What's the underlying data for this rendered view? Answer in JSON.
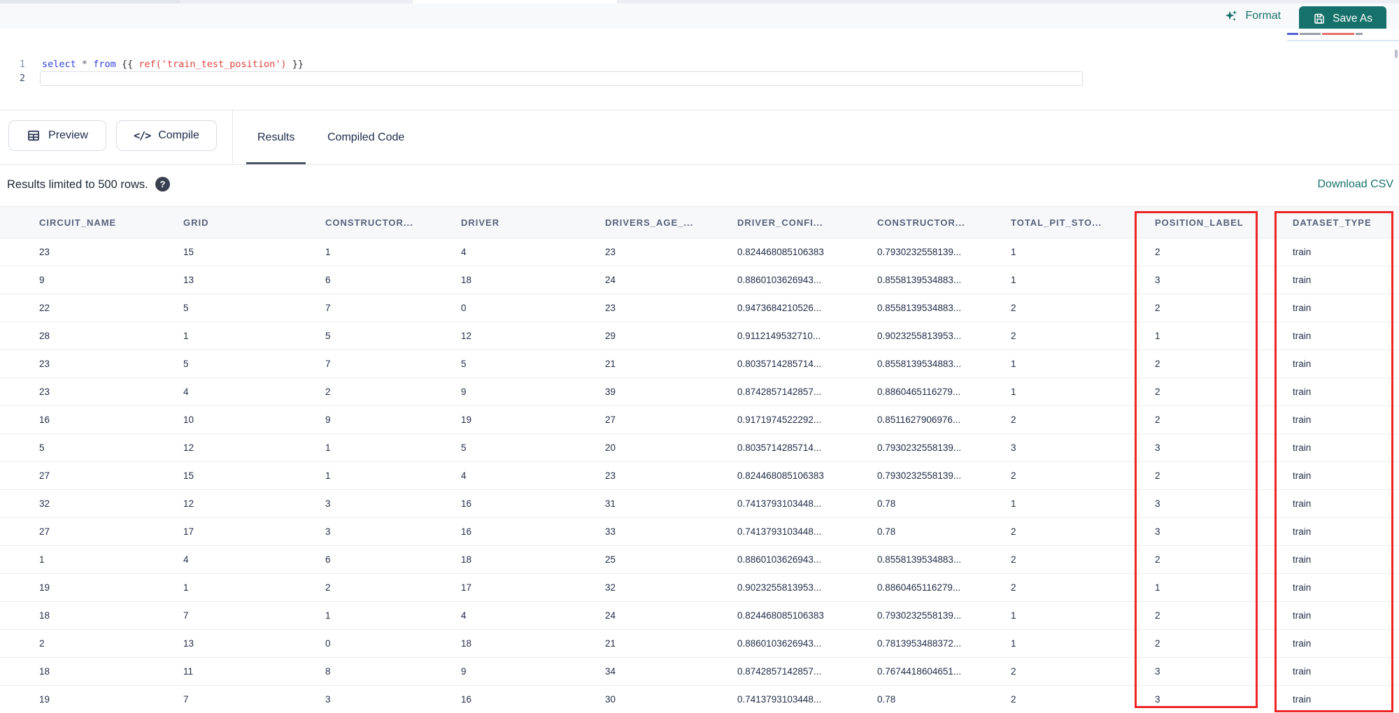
{
  "app": {
    "accent_teal": "#17716B",
    "annotation_red": "#EE2424"
  },
  "toolbar": {
    "format_label": "Format",
    "save_as_label": "Save As"
  },
  "editor": {
    "line_numbers": [
      "1",
      "2"
    ],
    "code_tokens": [
      {
        "text": "select",
        "type": "keyword"
      },
      {
        "text": " ",
        "type": "plain"
      },
      {
        "text": "*",
        "type": "operator"
      },
      {
        "text": " ",
        "type": "plain"
      },
      {
        "text": "from",
        "type": "keyword"
      },
      {
        "text": " {{ ",
        "type": "plain"
      },
      {
        "text": "ref('train_test_position')",
        "type": "string"
      },
      {
        "text": " }}",
        "type": "plain"
      }
    ]
  },
  "action_bar": {
    "preview_label": "Preview",
    "compile_label": "Compile",
    "compile_icon_text": "</>",
    "tabs": [
      {
        "label": "Results",
        "active": true
      },
      {
        "label": "Compiled Code",
        "active": false
      }
    ]
  },
  "results_bar": {
    "limit_text": "Results limited to 500 rows.",
    "help_icon": "?",
    "download_csv_label": "Download CSV"
  },
  "table": {
    "headers": [
      "CIRCUIT_NAME",
      "GRID",
      "CONSTRUCTOR...",
      "DRIVER",
      "DRIVERS_AGE_...",
      "DRIVER_CONFI...",
      "CONSTRUCTOR...",
      "TOTAL_PIT_STO...",
      "POSITION_LABEL",
      "DATASET_TYPE"
    ],
    "highlighted_columns": [
      "POSITION_LABEL",
      "DATASET_TYPE"
    ],
    "rows": [
      [
        "23",
        "15",
        "1",
        "4",
        "23",
        "0.824468085106383",
        "0.7930232558139...",
        "1",
        "2",
        "train"
      ],
      [
        "9",
        "13",
        "6",
        "18",
        "24",
        "0.8860103626943...",
        "0.8558139534883...",
        "1",
        "3",
        "train"
      ],
      [
        "22",
        "5",
        "7",
        "0",
        "23",
        "0.9473684210526...",
        "0.8558139534883...",
        "2",
        "2",
        "train"
      ],
      [
        "28",
        "1",
        "5",
        "12",
        "29",
        "0.9112149532710...",
        "0.9023255813953...",
        "2",
        "1",
        "train"
      ],
      [
        "23",
        "5",
        "7",
        "5",
        "21",
        "0.8035714285714...",
        "0.8558139534883...",
        "1",
        "2",
        "train"
      ],
      [
        "23",
        "4",
        "2",
        "9",
        "39",
        "0.8742857142857...",
        "0.8860465116279...",
        "1",
        "2",
        "train"
      ],
      [
        "16",
        "10",
        "9",
        "19",
        "27",
        "0.9171974522292...",
        "0.8511627906976...",
        "2",
        "2",
        "train"
      ],
      [
        "5",
        "12",
        "1",
        "5",
        "20",
        "0.8035714285714...",
        "0.7930232558139...",
        "3",
        "3",
        "train"
      ],
      [
        "27",
        "15",
        "1",
        "4",
        "23",
        "0.824468085106383",
        "0.7930232558139...",
        "2",
        "2",
        "train"
      ],
      [
        "32",
        "12",
        "3",
        "16",
        "31",
        "0.7413793103448...",
        "0.78",
        "1",
        "3",
        "train"
      ],
      [
        "27",
        "17",
        "3",
        "16",
        "33",
        "0.7413793103448...",
        "0.78",
        "2",
        "3",
        "train"
      ],
      [
        "1",
        "4",
        "6",
        "18",
        "25",
        "0.8860103626943...",
        "0.8558139534883...",
        "2",
        "2",
        "train"
      ],
      [
        "19",
        "1",
        "2",
        "17",
        "32",
        "0.9023255813953...",
        "0.8860465116279...",
        "2",
        "1",
        "train"
      ],
      [
        "18",
        "7",
        "1",
        "4",
        "24",
        "0.824468085106383",
        "0.7930232558139...",
        "1",
        "2",
        "train"
      ],
      [
        "2",
        "13",
        "0",
        "18",
        "21",
        "0.8860103626943...",
        "0.7813953488372...",
        "1",
        "2",
        "train"
      ],
      [
        "18",
        "11",
        "8",
        "9",
        "34",
        "0.8742857142857...",
        "0.7674418604651...",
        "2",
        "3",
        "train"
      ],
      [
        "19",
        "7",
        "3",
        "16",
        "30",
        "0.7413793103448...",
        "0.78",
        "2",
        "3",
        "train"
      ]
    ]
  }
}
